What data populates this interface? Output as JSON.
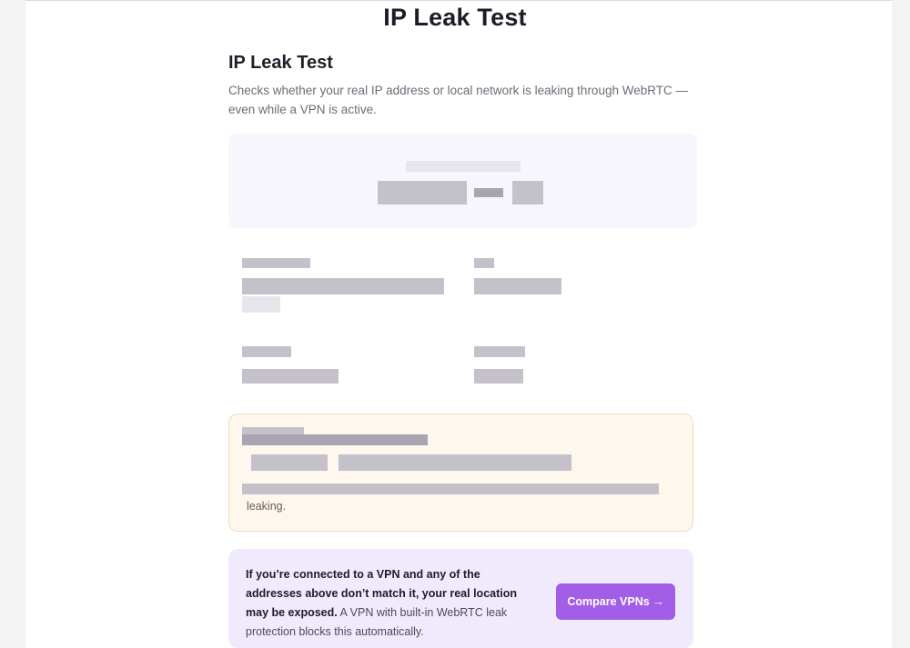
{
  "page": {
    "heading": "IP Leak Test"
  },
  "section": {
    "title": "IP Leak Test",
    "description": "Checks whether your real IP address or local network is leaking through WebRTC — even while a VPN is active."
  },
  "warning": {
    "tail_text": "leaking."
  },
  "cta": {
    "bold_text": "If you’re connected to a VPN and any of the addresses above don’t match it, your real location may be exposed.",
    "normal_text": " A VPN with built-in WebRTC leak protection blocks this automatically.",
    "button_label": "Compare VPNs →"
  },
  "colors": {
    "accent": "#a25ee7",
    "warning_bg": "#fef7ee",
    "cta_bg": "#f1eafd"
  }
}
